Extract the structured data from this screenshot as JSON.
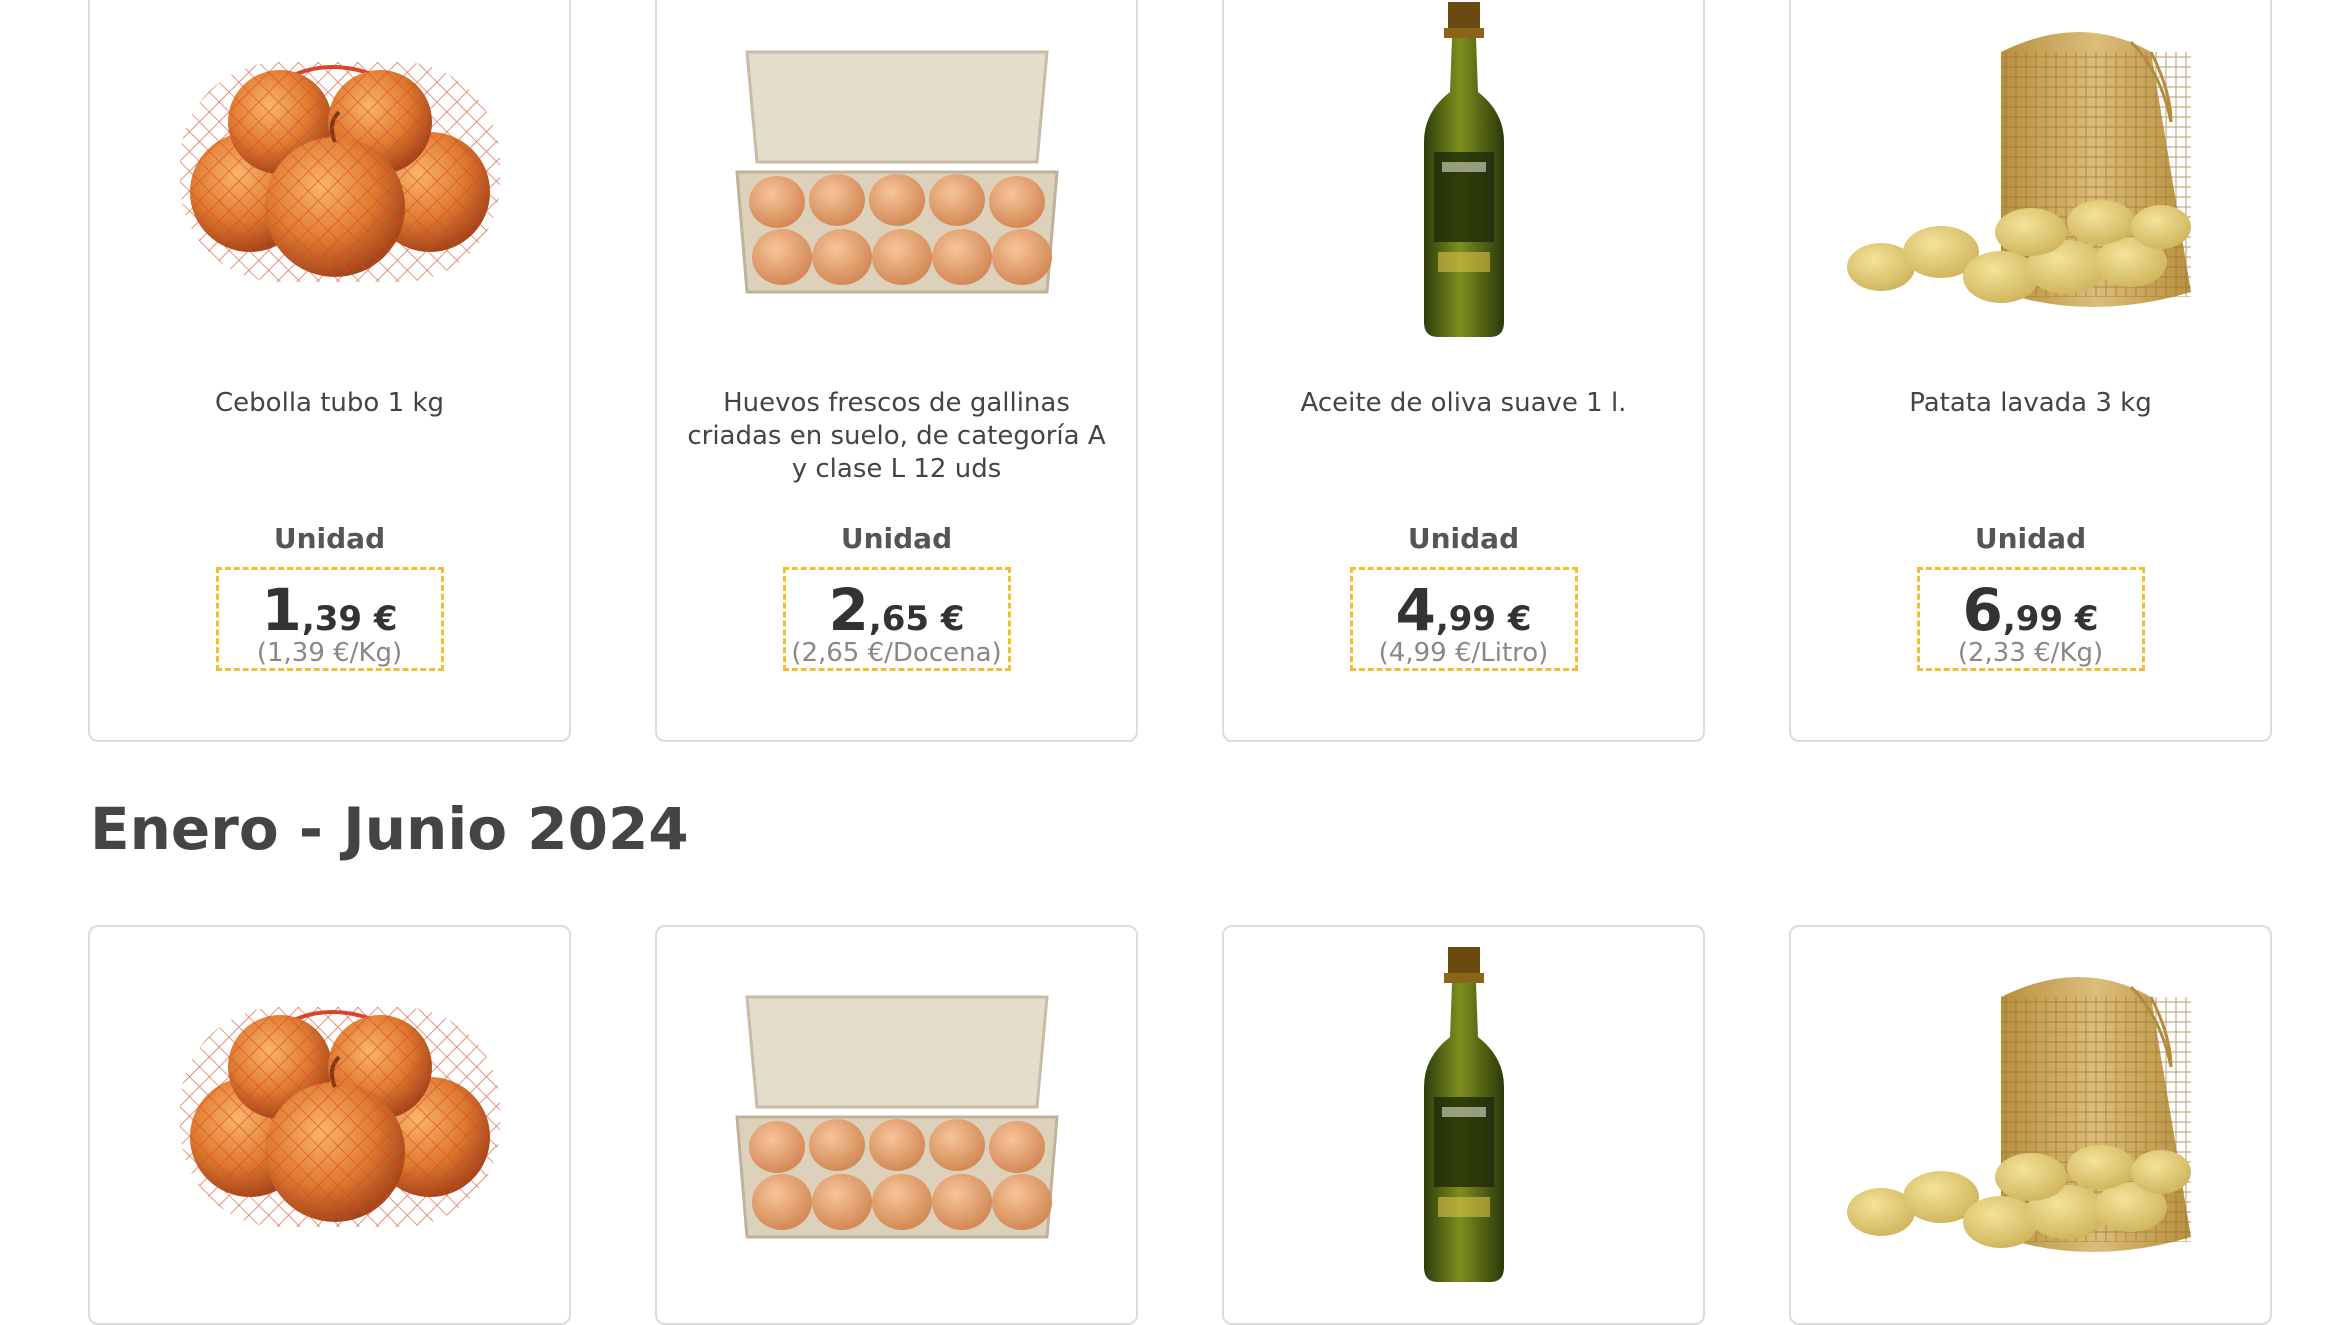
{
  "section": {
    "title": "Enero - Junio 2024"
  },
  "products": [
    {
      "name": "Cebolla tubo 1 kg",
      "unit": "Unidad",
      "price_int": "1",
      "price_dec": ",39 €",
      "unit_price": "(1,39 €/Kg)",
      "image": "onion-bag-image"
    },
    {
      "name": "Huevos frescos de gallinas criadas en suelo, de categoría A y clase L 12 uds",
      "unit": "Unidad",
      "price_int": "2",
      "price_dec": ",65 €",
      "unit_price": "(2,65 €/Docena)",
      "image": "egg-carton-image"
    },
    {
      "name": "Aceite de oliva suave 1 l.",
      "unit": "Unidad",
      "price_int": "4",
      "price_dec": ",99 €",
      "unit_price": "(4,99 €/Litro)",
      "image": "olive-oil-bottle-image"
    },
    {
      "name": "Patata lavada 3 kg",
      "unit": "Unidad",
      "price_int": "6",
      "price_dec": ",99 €",
      "unit_price": "(2,33 €/Kg)",
      "image": "potato-sack-image"
    }
  ],
  "colors": {
    "price_border": "#f0c030",
    "card_border": "#dcdcdc"
  }
}
